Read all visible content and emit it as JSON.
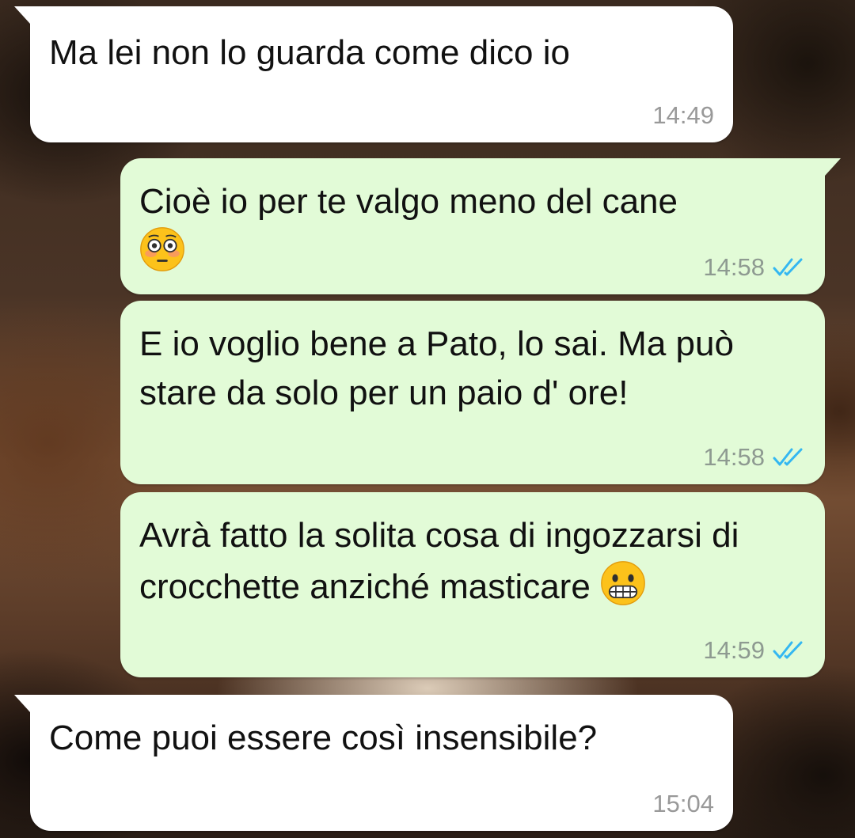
{
  "messages": [
    {
      "direction": "in",
      "text": "Ma lei non lo guarda come dico io",
      "time": "14:49"
    },
    {
      "direction": "out",
      "text": "Cioè io per te valgo meno del cane",
      "emoji": "flushed-face-icon",
      "time": "14:58",
      "status": "read"
    },
    {
      "direction": "out",
      "text": "E io voglio bene a Pato, lo sai. Ma può stare da solo per un paio d' ore!",
      "time": "14:58",
      "status": "read"
    },
    {
      "direction": "out",
      "text": "Avrà fatto la solita cosa di ingozzarsi di crocchette anziché masticare",
      "emoji": "grimacing-face-icon",
      "time": "14:59",
      "status": "read"
    },
    {
      "direction": "in",
      "text": "Come puoi essere così insensibile?",
      "time": "15:04"
    }
  ],
  "colors": {
    "incoming_bubble": "#ffffff",
    "outgoing_bubble": "#e2fbd7",
    "read_ticks": "#34b7f1",
    "time_text": "#999999"
  }
}
